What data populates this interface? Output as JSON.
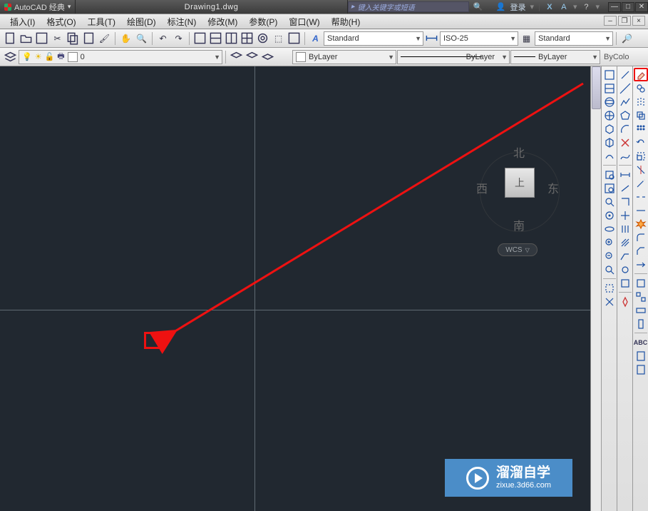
{
  "title": {
    "workspace": "AutoCAD 经典",
    "dropdown_icon": "▾",
    "document": "Drawing1.dwg",
    "search_placeholder": "键入关键字或短语",
    "login": "登录",
    "help_icon": "?",
    "x_icon": "X",
    "a_icon": "A"
  },
  "menu": {
    "items": [
      "插入(I)",
      "格式(O)",
      "工具(T)",
      "绘图(D)",
      "标注(N)",
      "修改(M)",
      "参数(P)",
      "窗口(W)",
      "帮助(H)"
    ]
  },
  "std_toolbar": {
    "block_icon": "▦",
    "text_style": "Standard",
    "dim_style": "ISO-25",
    "table_style": "Standard"
  },
  "layer_row": {
    "layer_name": "0",
    "linetype": "ByLayer",
    "lineweight": "ByLayer",
    "plot_style": "ByLayer",
    "bycolor": "ByColo"
  },
  "viewcube": {
    "north": "北",
    "south": "南",
    "east": "东",
    "west": "西",
    "top": "上",
    "wcs": "WCS"
  },
  "watermark": {
    "brand": "溜溜自学",
    "url": "zixue.3d66.com"
  }
}
